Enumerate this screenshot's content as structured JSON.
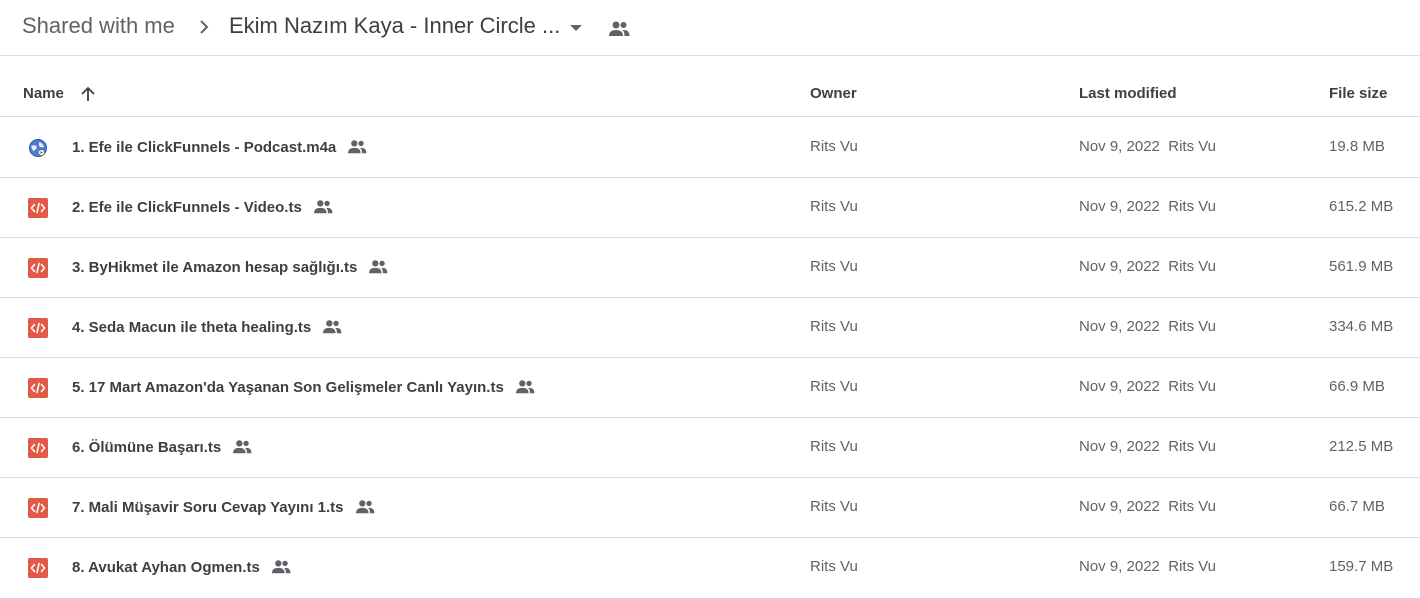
{
  "breadcrumb": {
    "root": "Shared with me",
    "current": "Ekim Nazım Kaya - Inner Circle ..."
  },
  "columns": {
    "name": "Name",
    "owner": "Owner",
    "last_modified": "Last modified",
    "file_size": "File size"
  },
  "colors": {
    "video_icon": "#e05a47",
    "text_primary": "#3c4043",
    "text_secondary": "#5f6368",
    "divider": "#dadce0"
  },
  "files": [
    {
      "name": "1. Efe ile ClickFunnels - Podcast.m4a",
      "icon": "globe-audio-icon",
      "owner": "Rits Vu",
      "modified": "Nov 9, 2022",
      "modified_by": "Rits Vu",
      "size": "19.8 MB"
    },
    {
      "name": "2. Efe ile ClickFunnels - Video.ts",
      "icon": "code-file-icon",
      "owner": "Rits Vu",
      "modified": "Nov 9, 2022",
      "modified_by": "Rits Vu",
      "size": "615.2 MB"
    },
    {
      "name": "3. ByHikmet ile Amazon hesap sağlığı.ts",
      "icon": "code-file-icon",
      "owner": "Rits Vu",
      "modified": "Nov 9, 2022",
      "modified_by": "Rits Vu",
      "size": "561.9 MB"
    },
    {
      "name": "4. Seda Macun ile theta healing.ts",
      "icon": "code-file-icon",
      "owner": "Rits Vu",
      "modified": "Nov 9, 2022",
      "modified_by": "Rits Vu",
      "size": "334.6 MB"
    },
    {
      "name": "5. 17 Mart Amazon'da Yaşanan Son Gelişmeler Canlı Yayın.ts",
      "icon": "code-file-icon",
      "owner": "Rits Vu",
      "modified": "Nov 9, 2022",
      "modified_by": "Rits Vu",
      "size": "66.9 MB"
    },
    {
      "name": "6. Ölümüne Başarı.ts",
      "icon": "code-file-icon",
      "owner": "Rits Vu",
      "modified": "Nov 9, 2022",
      "modified_by": "Rits Vu",
      "size": "212.5 MB"
    },
    {
      "name": "7. Mali Müşavir Soru Cevap Yayını 1.ts",
      "icon": "code-file-icon",
      "owner": "Rits Vu",
      "modified": "Nov 9, 2022",
      "modified_by": "Rits Vu",
      "size": "66.7 MB"
    },
    {
      "name": "8. Avukat Ayhan Ogmen.ts",
      "icon": "code-file-icon",
      "owner": "Rits Vu",
      "modified": "Nov 9, 2022",
      "modified_by": "Rits Vu",
      "size": "159.7 MB"
    }
  ]
}
